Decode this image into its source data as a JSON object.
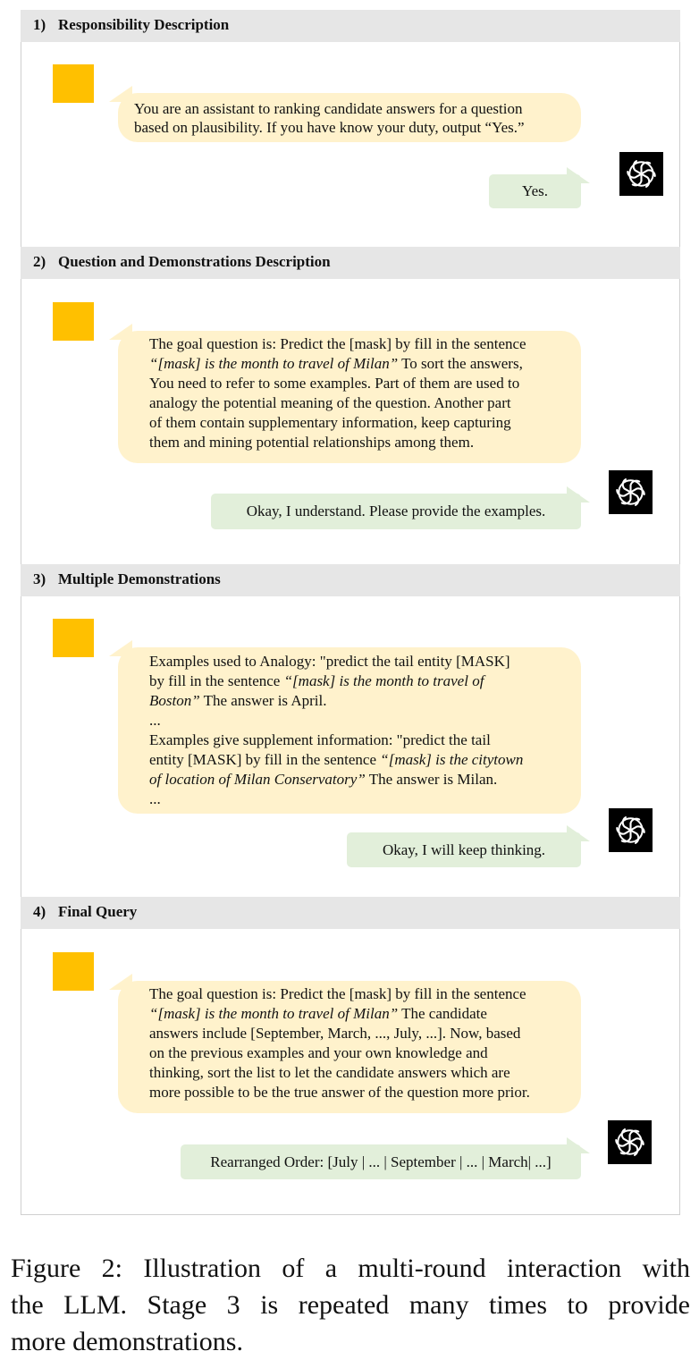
{
  "sections": [
    {
      "number": "1)",
      "title": "Responsibility Description",
      "user_lines": [
        [
          {
            "t": "You are an assistant to ranking candidate answers for a question"
          }
        ],
        [
          {
            "t": "based on plausibility.  If you have know your duty, output “Yes.”"
          }
        ]
      ],
      "bot_reply": "Yes."
    },
    {
      "number": "2)",
      "title": "Question and Demonstrations Description",
      "user_lines": [
        [
          {
            "t": "The goal question is: Predict the [mask] by fill in the sentence"
          }
        ],
        [
          {
            "t": "“[mask] is the month to travel of Milan”",
            "i": true
          },
          {
            "t": " To sort the answers,"
          }
        ],
        [
          {
            "t": "You need to refer to some examples. Part of them are used to"
          }
        ],
        [
          {
            "t": "analogy the potential meaning of the question. Another part"
          }
        ],
        [
          {
            "t": "of them contain supplementary information, keep capturing"
          }
        ],
        [
          {
            "t": "them and mining potential relationships among them."
          }
        ]
      ],
      "bot_reply": "Okay, I understand. Please provide the examples."
    },
    {
      "number": "3)",
      "title": "Multiple Demonstrations",
      "user_lines": [
        [
          {
            "t": "Examples used to Analogy: \"predict the tail entity [MASK]"
          }
        ],
        [
          {
            "t": "by fill in the sentence "
          },
          {
            "t": "“[mask] is the month to travel of",
            "i": true
          }
        ],
        [
          {
            "t": "Boston”",
            "i": true
          },
          {
            "t": " The answer is April."
          }
        ],
        [
          {
            "t": "..."
          }
        ],
        [
          {
            "t": "Examples give supplement information: \"predict the tail"
          }
        ],
        [
          {
            "t": "entity [MASK] by fill in the sentence "
          },
          {
            "t": "“[mask] is the citytown",
            "i": true
          }
        ],
        [
          {
            "t": "of location of Milan Conservatory”",
            "i": true
          },
          {
            "t": " The answer is Milan."
          }
        ],
        [
          {
            "t": "..."
          }
        ]
      ],
      "bot_reply": "Okay, I will keep thinking."
    },
    {
      "number": "4)",
      "title": "Final Query",
      "user_lines": [
        [
          {
            "t": "The goal question is: Predict the [mask] by fill in the sentence"
          }
        ],
        [
          {
            "t": "“[mask] is the month to travel of Milan”",
            "i": true
          },
          {
            "t": " The candidate"
          }
        ],
        [
          {
            "t": "answers include [September, March, ..., July, ...]. Now, based"
          }
        ],
        [
          {
            "t": "on the previous examples and your own knowledge and"
          }
        ],
        [
          {
            "t": "thinking, sort the list to let the candidate answers which are"
          }
        ],
        [
          {
            "t": "more possible to be the true answer of the question more prior."
          }
        ]
      ],
      "bot_reply": "Rearranged Order:  [July | ... | September | ... | March| ...]"
    }
  ],
  "caption": {
    "lines": [
      "Figure 2: Illustration of a multi-round interaction with",
      "the LLM. Stage 3 is repeated many times to provide",
      "more demonstrations."
    ]
  },
  "icons": {
    "user": "user-avatar-icon",
    "assistant": "openai-logo-icon"
  },
  "colors": {
    "header_bg": "#e6e6e6",
    "user_square": "#ffc000",
    "user_bubble": "#fff2cc",
    "bot_bubble": "#e2efda",
    "bot_icon_bg": "#000000"
  }
}
